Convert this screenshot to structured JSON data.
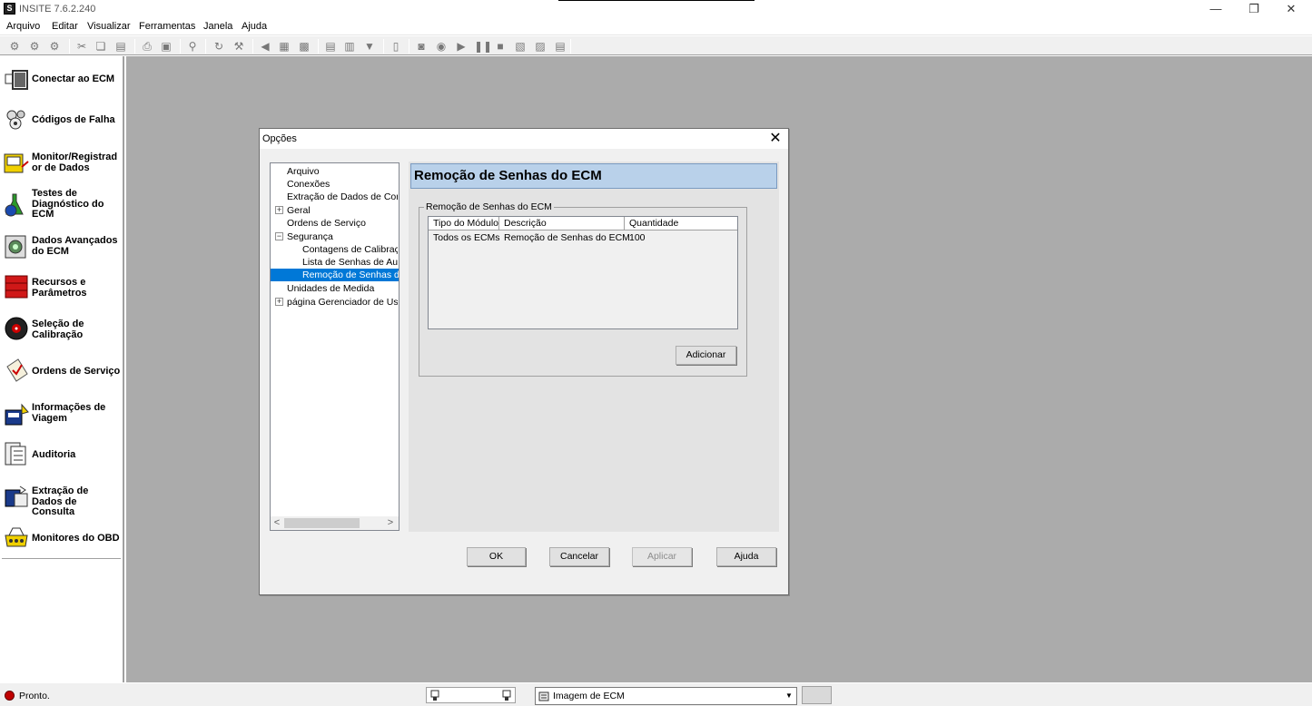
{
  "app": {
    "title": "INSITE 7.6.2.240",
    "icon_letter": "S"
  },
  "window_controls": {
    "minimize": "—",
    "restore": "❐",
    "close": "✕"
  },
  "menu": [
    "Arquivo",
    "Editar",
    "Visualizar",
    "Ferramentas",
    "Janela",
    "Ajuda"
  ],
  "toolbar_icons": [
    "connect-icon",
    "disconnect-icon",
    "ecm-icon",
    "cut-icon",
    "copy-icon",
    "paste-icon",
    "print-icon",
    "print-preview-icon",
    "find-icon",
    "refresh-icon",
    "tools-icon",
    "back-icon",
    "monitor-icon",
    "record-icon",
    "document-icon",
    "folder-icon",
    "filter-icon",
    "page-icon",
    "camera-icon",
    "play-back-icon",
    "play-icon",
    "pause-icon",
    "stop-icon",
    "snapshot-icon",
    "export-icon",
    "edit-icon"
  ],
  "sidebar": {
    "items": [
      {
        "label": "Conectar ao ECM",
        "icon": "connector-icon",
        "color": "#333333"
      },
      {
        "label": "Códigos de Falha",
        "icon": "fault-codes-icon",
        "color": "#555555"
      },
      {
        "label": "Monitor/Registrad or de Dados",
        "icon": "data-monitor-icon",
        "color": "#c8a800"
      },
      {
        "label": "Testes de Diagnóstico do ECM",
        "icon": "diagnostic-flask-icon",
        "color": "#1e7a1e"
      },
      {
        "label": "Dados Avançados do ECM",
        "icon": "advanced-data-icon",
        "color": "#2a6a2a"
      },
      {
        "label": "Recursos e Parâmetros",
        "icon": "toolbox-icon",
        "color": "#cc1111"
      },
      {
        "label": "Seleção de Calibração",
        "icon": "calibration-disc-icon",
        "color": "#aa0000"
      },
      {
        "label": "Ordens de Serviço",
        "icon": "work-order-icon",
        "color": "#8a6a2a"
      },
      {
        "label": "Informações de Viagem",
        "icon": "trip-info-icon",
        "color": "#1a3a8a"
      },
      {
        "label": "Auditoria",
        "icon": "audit-icon",
        "color": "#333333"
      },
      {
        "label": "Extração de Dados de Consulta",
        "icon": "data-extraction-icon",
        "color": "#1a3a8a"
      },
      {
        "label": "Monitores do OBD",
        "icon": "obd-monitor-icon",
        "color": "#c8a800"
      }
    ]
  },
  "dialog": {
    "title": "Opções",
    "close": "✕",
    "tree": [
      {
        "label": "Arquivo",
        "level": 0,
        "expander": ""
      },
      {
        "label": "Conexões",
        "level": 0,
        "expander": ""
      },
      {
        "label": "Extração de Dados de Consulta",
        "level": 0,
        "expander": ""
      },
      {
        "label": "Geral",
        "level": 0,
        "expander": "+"
      },
      {
        "label": "Ordens de Serviço",
        "level": 0,
        "expander": ""
      },
      {
        "label": "Segurança",
        "level": 0,
        "expander": "−"
      },
      {
        "label": "Contagens de Calibração",
        "level": 1,
        "expander": ""
      },
      {
        "label": "Lista de Senhas de Autorização",
        "level": 1,
        "expander": ""
      },
      {
        "label": "Remoção de Senhas do ECM",
        "level": 1,
        "expander": "",
        "selected": true
      },
      {
        "label": "Unidades de Medida",
        "level": 0,
        "expander": ""
      },
      {
        "label": "página Gerenciador de Usuários",
        "level": 0,
        "expander": "+"
      }
    ],
    "tree_scroll": {
      "left": "<",
      "right": ">"
    },
    "panel_header": "Remoção de Senhas do ECM",
    "group_label": "Remoção de Senhas do ECM",
    "table": {
      "columns": [
        "Tipo do Módulo",
        "Descrição",
        "Quantidade"
      ],
      "rows": [
        [
          "Todos os ECMs",
          "Remoção de Senhas do ECM",
          "100"
        ]
      ]
    },
    "add_button": "Adicionar",
    "buttons": {
      "ok": "OK",
      "cancel": "Cancelar",
      "apply": "Aplicar",
      "help": "Ajuda"
    }
  },
  "statusbar": {
    "status": "Pronto.",
    "status_color": "#c00000",
    "ecm_image_label": "Imagem de ECM"
  }
}
